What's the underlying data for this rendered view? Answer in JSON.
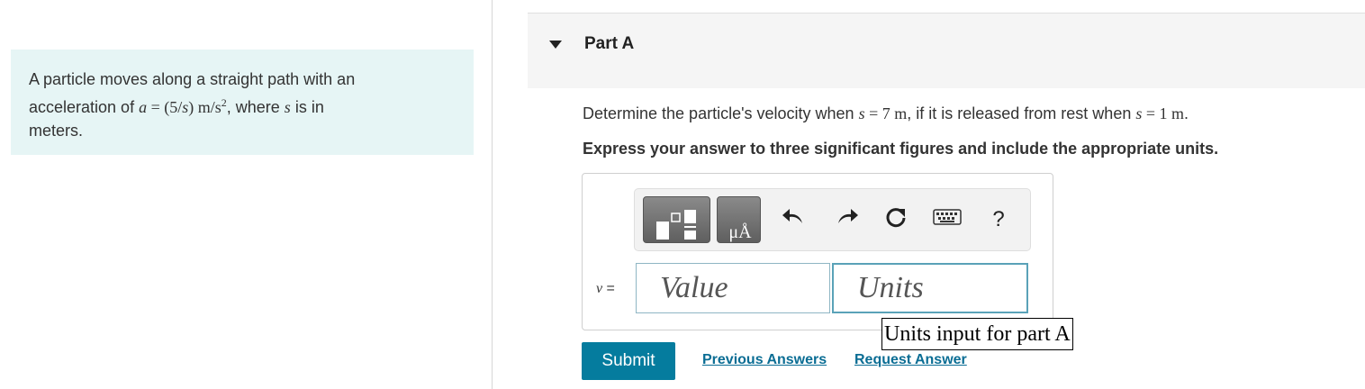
{
  "problem": {
    "line1": "A particle moves along a straight path with an",
    "line2_prefix": "acceleration of ",
    "a_var": "a",
    "eq": " = (5/",
    "s_var": "s",
    "eq_close": ")  m/s",
    "exp": "2",
    "line2_suffix": ", where ",
    "s_var2": "s",
    "line2_end": " is in",
    "line3": "meters."
  },
  "part": {
    "title": "Part A"
  },
  "question": {
    "prefix": "Determine the particle's velocity when ",
    "s1": "s",
    "eq1": " = 7 m",
    "middle": ", if it is released from rest when ",
    "s2": "s",
    "eq2": " = 1 m",
    "end": "."
  },
  "instruction": "Express your answer to three significant figures and include the appropriate units.",
  "toolbar": {
    "icons": [
      "templates-icon",
      "units-icon",
      "undo-icon",
      "redo-icon",
      "reset-icon",
      "keyboard-icon",
      "help-icon"
    ],
    "help_label": "?",
    "units_glyph": "μÅ"
  },
  "answer": {
    "variable": "v",
    "eq_sign": " =",
    "value_placeholder": "Value",
    "units_placeholder": "Units",
    "units_tooltip": "Units input for part A"
  },
  "actions": {
    "submit": "Submit",
    "previous_answers": "Previous Answers",
    "request_answer": "Request Answer"
  },
  "colors": {
    "problem_bg": "#e6f5f5",
    "submit_bg": "#057c9e",
    "link": "#0a6d94"
  }
}
